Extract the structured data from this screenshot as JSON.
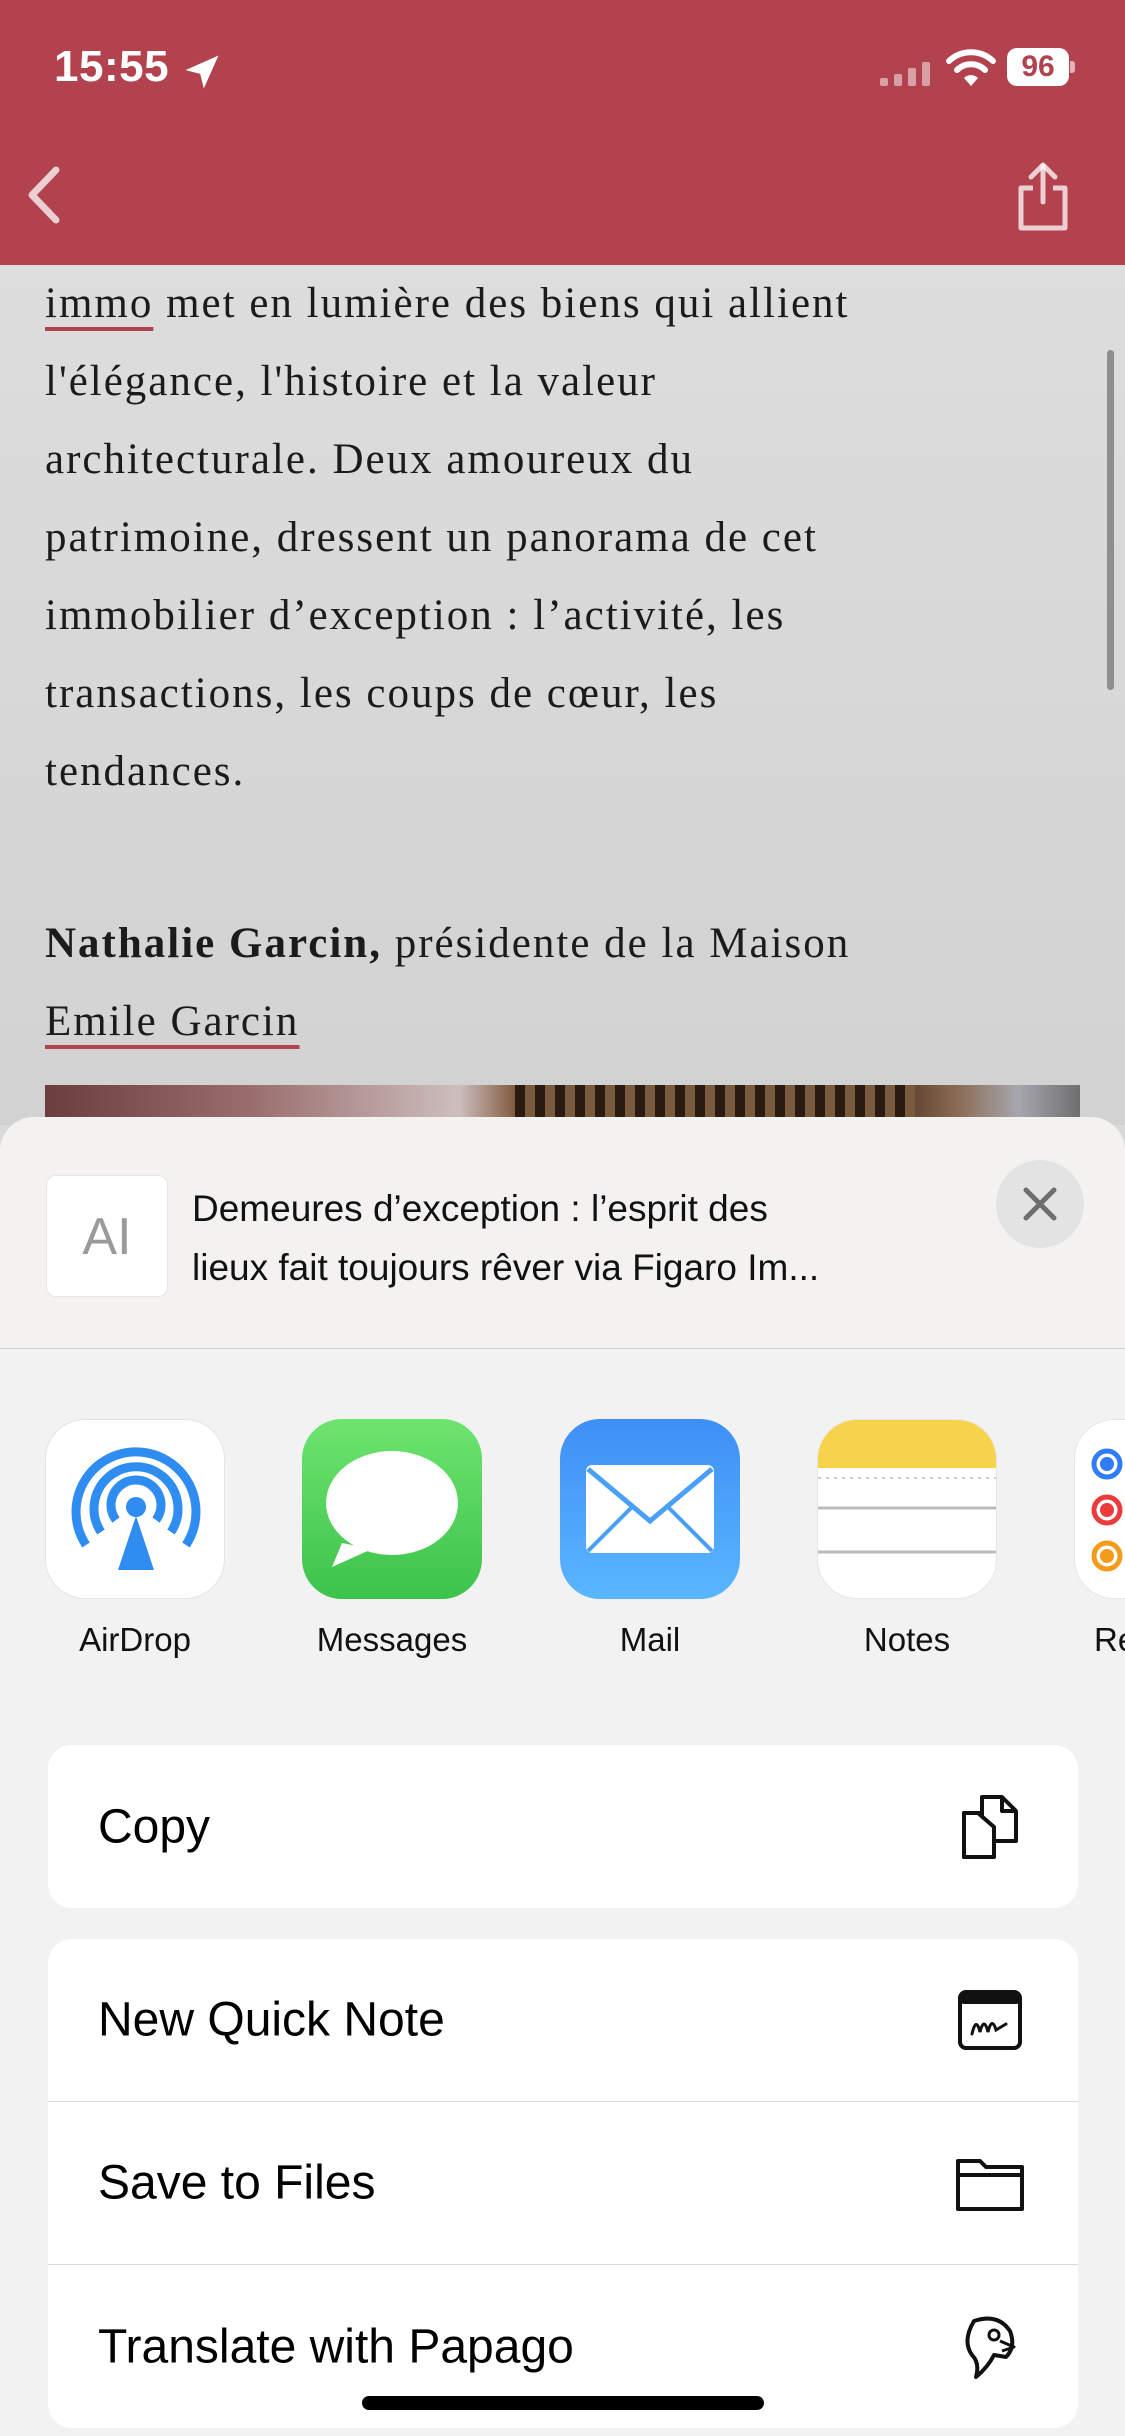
{
  "status_bar": {
    "time": "15:55",
    "battery": "96"
  },
  "article": {
    "lines": [
      {
        "underlined": "immo",
        "rest": " met en lumière des biens qui allient"
      },
      {
        "text": "l'élégance, l'histoire et la valeur"
      },
      {
        "text": "architecturale. Deux amoureux du"
      },
      {
        "text": "patrimoine, dressent un panorama de cet"
      },
      {
        "text": "immobilier d’exception : l’activité, les"
      },
      {
        "text": "transactions, les coups de cœur, les"
      },
      {
        "text": "tendances."
      }
    ],
    "author_name": "Nathalie Garcin,",
    "author_role": " présidente de la Maison",
    "author_company": "Emile Garcin"
  },
  "share_sheet": {
    "thumb_label": "AI",
    "title_line1": "Demeures d’exception : l’esprit des",
    "title_line2": "lieux fait toujours rêver via Figaro Im...",
    "apps": [
      {
        "label": "AirDrop",
        "icon": "airdrop-icon"
      },
      {
        "label": "Messages",
        "icon": "messages-icon"
      },
      {
        "label": "Mail",
        "icon": "mail-icon"
      },
      {
        "label": "Notes",
        "icon": "notes-icon"
      },
      {
        "label": "Ren",
        "icon": "reminders-icon"
      }
    ],
    "actions": [
      {
        "label": "Copy",
        "icon": "copy-icon"
      },
      {
        "label": "New Quick Note",
        "icon": "quick-note-icon"
      },
      {
        "label": "Save to Files",
        "icon": "folder-icon"
      },
      {
        "label": "Translate with Papago",
        "icon": "papago-icon"
      }
    ]
  },
  "colors": {
    "brand": "#b2424d",
    "sheet_bg": "#f2f2f2"
  }
}
